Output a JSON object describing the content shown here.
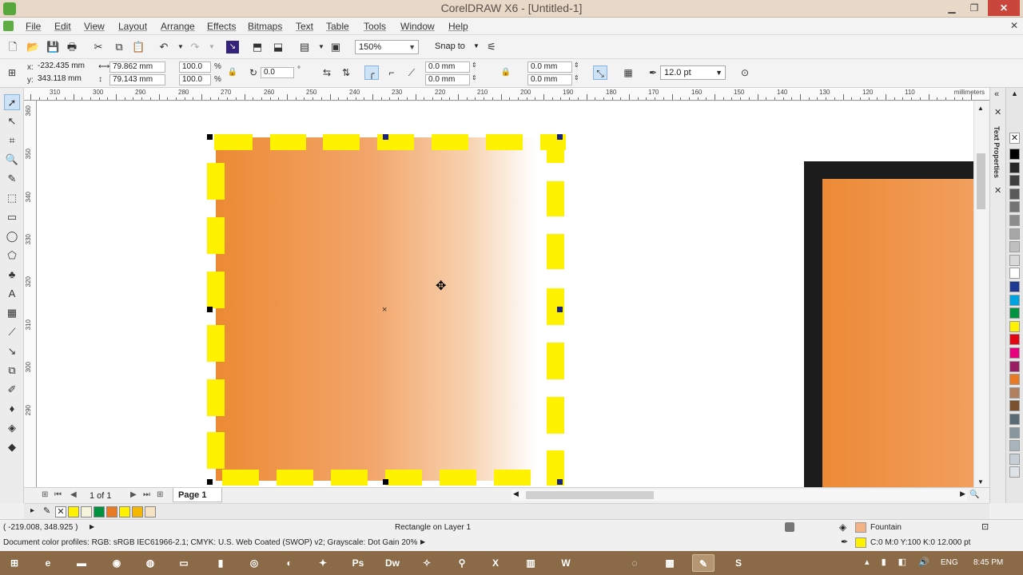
{
  "window": {
    "title": "CorelDRAW X6 - [Untitled-1]",
    "minimize": "▁",
    "maximize": "❐",
    "close": "✕"
  },
  "menu": {
    "items": [
      "File",
      "Edit",
      "View",
      "Layout",
      "Arrange",
      "Effects",
      "Bitmaps",
      "Text",
      "Table",
      "Tools",
      "Window",
      "Help"
    ],
    "close": "✕"
  },
  "standard_toolbar": {
    "zoom_level": "150%",
    "snap_to": "Snap to"
  },
  "property_bar": {
    "x_label": "x:",
    "y_label": "y:",
    "x": "-232.435 mm",
    "y": "343.118 mm",
    "width": "79.862 mm",
    "height": "79.143 mm",
    "scale_x": "100.0",
    "scale_y": "100.0",
    "percent": "%",
    "rotation": "0.0",
    "degree": "°",
    "corner_1": "0.0 mm",
    "corner_2": "0.0 mm",
    "corner_3": "0.0 mm",
    "corner_4": "0.0 mm",
    "outline_width": "12.0 pt"
  },
  "ruler": {
    "units": "millimeters",
    "h_ticks": [
      "310",
      "300",
      "290",
      "280",
      "270",
      "260",
      "250",
      "240",
      "230",
      "220",
      "210",
      "200",
      "190",
      "180",
      "170",
      "160",
      "150",
      "140",
      "130",
      "120",
      "110"
    ],
    "v_ticks": [
      "360",
      "350",
      "340",
      "330",
      "320",
      "310",
      "300",
      "290"
    ]
  },
  "docker": {
    "label": "Text Properties"
  },
  "palette_colors": [
    "#000000",
    "#262626",
    "#404040",
    "#595959",
    "#737373",
    "#8c8c8c",
    "#a6a6a6",
    "#bfbfbf",
    "#d9d9d9",
    "#ffffff",
    "#1f3a93",
    "#00a3e0",
    "#00923f",
    "#fff200",
    "#e30613",
    "#e6007e",
    "#9b1d64",
    "#e87a24",
    "#b08060",
    "#7a5230",
    "#5a6b73",
    "#8896a0",
    "#a8b4bc",
    "#c6cfd6",
    "#dee3e7"
  ],
  "page_nav": {
    "count": "1 of 1",
    "tab": "Page 1"
  },
  "document_palette": [
    "#fff200",
    "#f5f5dc",
    "#00923f",
    "#e87a24",
    "#fff200",
    "#f5b700",
    "#f7e2c4"
  ],
  "status": {
    "coords": "( -219.008, 348.925 )",
    "object_info": "Rectangle on Layer 1",
    "color_profiles": "Document color profiles: RGB: sRGB IEC61966-2.1; CMYK: U.S. Web Coated (SWOP) v2; Grayscale: Dot Gain 20%",
    "fill_label": "Fountain",
    "outline_label": "C:0 M:0 Y:100 K:0  12.000 pt",
    "fill_color": "#f4b183",
    "outline_color": "#fff200"
  },
  "taskbar": {
    "lang": "ENG",
    "time": "8:45 PM"
  }
}
